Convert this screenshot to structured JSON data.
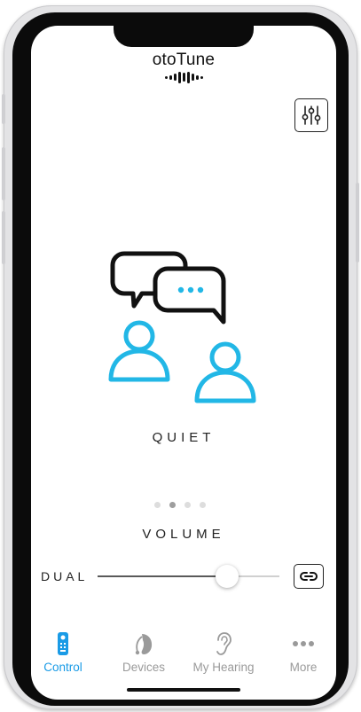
{
  "app": {
    "name": "otoTune"
  },
  "header": {
    "settings_icon": "sliders-icon"
  },
  "program": {
    "label": "QUIET",
    "icon": "conversation-icon",
    "pages": 4,
    "active_page": 2
  },
  "volume": {
    "label": "VOLUME",
    "mode_label": "DUAL",
    "level": 0.71,
    "link_icon": "link-icon"
  },
  "tabs": [
    {
      "label": "Control",
      "icon": "remote-icon",
      "active": true
    },
    {
      "label": "Devices",
      "icon": "hearing-aid-icon",
      "active": false
    },
    {
      "label": "My Hearing",
      "icon": "ear-icon",
      "active": false
    },
    {
      "label": "More",
      "icon": "more-dots-icon",
      "active": false
    }
  ],
  "colors": {
    "accent": "#1a9be6",
    "person": "#22b7e6",
    "inactive": "#9a9a9a",
    "text": "#222222"
  }
}
